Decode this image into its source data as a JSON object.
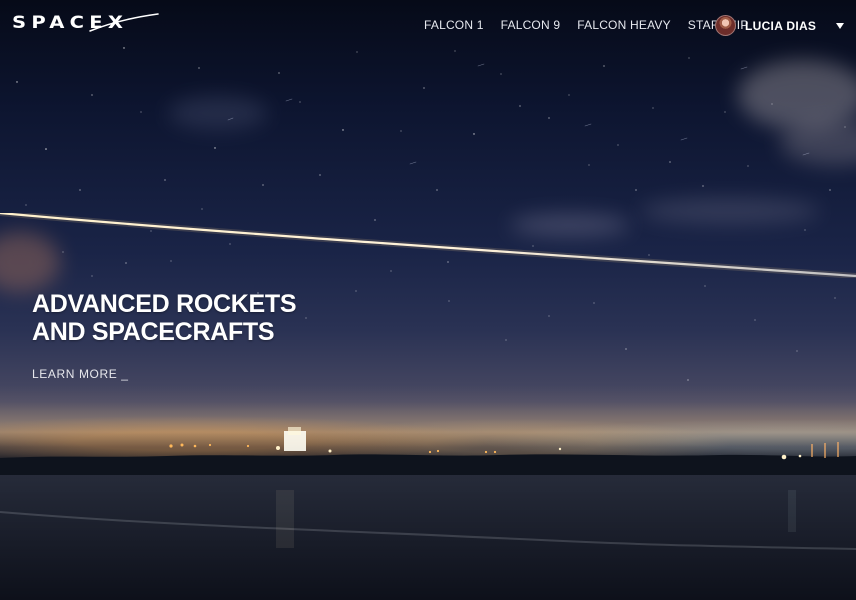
{
  "brand": {
    "logo_text": "SPACEX"
  },
  "nav": {
    "items": [
      "FALCON 1",
      "FALCON 9",
      "FALCON HEAVY",
      "STARSHIP"
    ]
  },
  "user": {
    "name": "LUCIA DIAS",
    "menu_icon": "chevron-down-icon"
  },
  "hero": {
    "title_line_1": "ADVANCED ROCKETS",
    "title_line_2": "AND SPACECRAFTS",
    "cta": "LEARN MORE _"
  },
  "colors": {
    "sky_top": "#060a18",
    "sky_mid": "#1a2447",
    "horizon_warm": "#8a7a6e",
    "text": "#ffffff"
  }
}
